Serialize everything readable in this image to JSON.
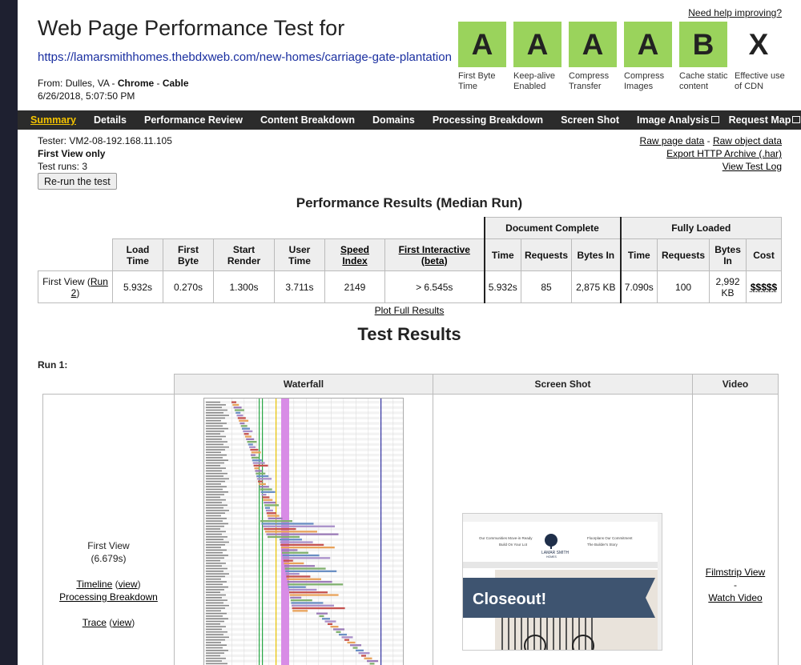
{
  "header": {
    "help_link": "Need help improving?",
    "title": "Web Page Performance Test for",
    "url": "https://lamarsmithhomes.thebdxweb.com/new-homes/carriage-gate-plantation",
    "from_label": "From:",
    "from_location": "Dulles, VA",
    "from_browser": "Chrome",
    "from_connection": "Cable",
    "datetime": "6/26/2018, 5:07:50 PM"
  },
  "grades": [
    {
      "grade": "A",
      "label": "First Byte Time",
      "color": "#9ad35c"
    },
    {
      "grade": "A",
      "label": "Keep-alive Enabled",
      "color": "#9ad35c"
    },
    {
      "grade": "A",
      "label": "Compress Transfer",
      "color": "#9ad35c"
    },
    {
      "grade": "A",
      "label": "Compress Images",
      "color": "#9ad35c"
    },
    {
      "grade": "B",
      "label": "Cache static content",
      "color": "#9ad35c"
    },
    {
      "grade": "X",
      "label": "Effective use of CDN",
      "color": "#ffffff"
    }
  ],
  "nav": {
    "items": [
      "Summary",
      "Details",
      "Performance Review",
      "Content Breakdown",
      "Domains",
      "Processing Breakdown",
      "Screen Shot",
      "Image Analysis",
      "Request Map"
    ],
    "active": "Summary"
  },
  "tester": {
    "line1": "Tester: VM2-08-192.168.11.105",
    "line2": "First View only",
    "line3": "Test runs: 3",
    "rerun_button": "Re-run the test"
  },
  "raw_links": {
    "page_data": "Raw page data",
    "separator": " - ",
    "object_data": "Raw object data",
    "har": "Export HTTP Archive (.har)",
    "log": "View Test Log"
  },
  "performance": {
    "heading": "Performance Results (Median Run)",
    "group_doc_complete": "Document Complete",
    "group_fully_loaded": "Fully Loaded",
    "headers": [
      "Load Time",
      "First Byte",
      "Start Render",
      "User Time",
      "Speed Index",
      "First Interactive (beta)",
      "Time",
      "Requests",
      "Bytes In",
      "Time",
      "Requests",
      "Bytes In",
      "Cost"
    ],
    "row_label_prefix": "First View (",
    "row_label_link": "Run 2",
    "row_label_suffix": ")",
    "values": [
      "5.932s",
      "0.270s",
      "1.300s",
      "3.711s",
      "2149",
      "> 6.545s",
      "5.932s",
      "85",
      "2,875 KB",
      "7.090s",
      "100",
      "2,992 KB",
      "$$$$$"
    ],
    "plot_link": "Plot Full Results"
  },
  "test_results": {
    "heading": "Test Results",
    "run_label": "Run 1:",
    "col_waterfall": "Waterfall",
    "col_screenshot": "Screen Shot",
    "col_video": "Video",
    "first_view": "First View",
    "first_view_time": "(6.679s)",
    "timeline": "Timeline",
    "view": "view",
    "processing": "Processing Breakdown",
    "trace": "Trace",
    "filmstrip": "Filmstrip View",
    "dash": "-",
    "watch_video": "Watch Video"
  },
  "screenshot_content": {
    "nav_left": "Our Communities  Move-in Ready",
    "nav_left2": "Build On Your Lot",
    "logo_name": "LAMAR SMITH",
    "logo_sub": "HOMES",
    "nav_right": "Floorplans  Our Commitment",
    "nav_right2": "The Builder's Story",
    "banner": "Closeout!"
  }
}
